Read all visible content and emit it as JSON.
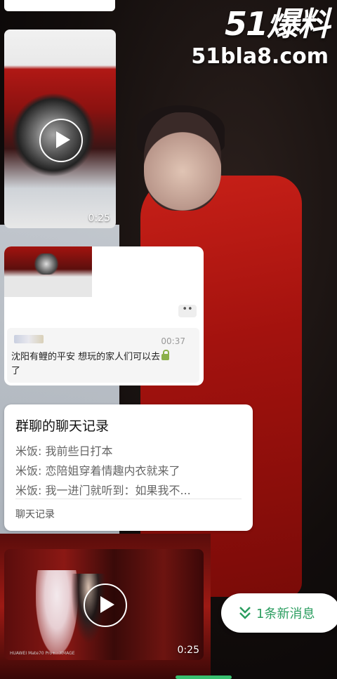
{
  "watermark": {
    "logo": "51爆料",
    "url": "51bla8.com"
  },
  "video1": {
    "duration": "0:25"
  },
  "quote_card": {
    "time": "00:37",
    "message": "沈阳有鲤的平安 想玩的家人们可以去",
    "message_tail": "了",
    "more_label": "••"
  },
  "chat_record": {
    "title": "群聊的聊天记录",
    "lines": [
      "米饭: 我前些日打本",
      "米饭: 恋陪姐穿着情趣内衣就来了",
      "米饭: 我一进门就听到：如果我不..."
    ],
    "footer": "聊天记录"
  },
  "video3": {
    "duration": "0:25",
    "camera_label": "HUAWEI Mate70 Pro+ · XMAGE"
  },
  "new_message_pill": {
    "label": "1条新消息"
  },
  "colors": {
    "accent_green": "#2a9d5f"
  },
  "icons": [
    "play-icon",
    "lock-icon",
    "double-chevron-down-icon"
  ]
}
